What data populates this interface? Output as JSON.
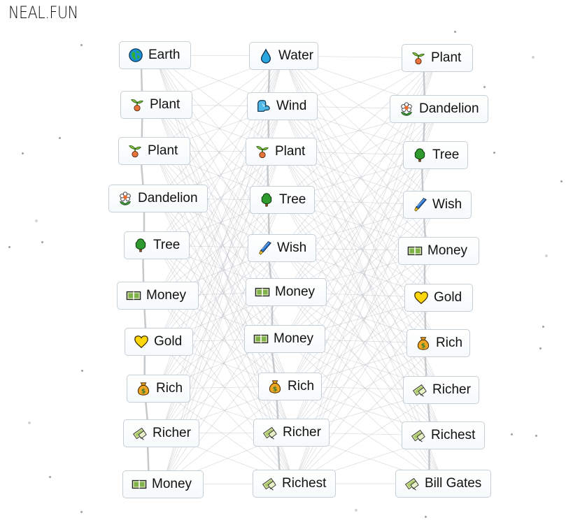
{
  "logo": "NEAL.FUN",
  "columns": [
    {
      "items": [
        {
          "label": "Earth",
          "icon": "earth"
        },
        {
          "label": "Plant",
          "icon": "plant"
        },
        {
          "label": "Plant",
          "icon": "plant"
        },
        {
          "label": "Dandelion",
          "icon": "dandelion"
        },
        {
          "label": "Tree",
          "icon": "tree"
        },
        {
          "label": "Money",
          "icon": "money"
        },
        {
          "label": "Gold",
          "icon": "gold"
        },
        {
          "label": "Rich",
          "icon": "rich"
        },
        {
          "label": "Richer",
          "icon": "richer"
        },
        {
          "label": "Money",
          "icon": "money"
        }
      ]
    },
    {
      "items": [
        {
          "label": "Water",
          "icon": "water"
        },
        {
          "label": "Wind",
          "icon": "wind"
        },
        {
          "label": "Plant",
          "icon": "plant"
        },
        {
          "label": "Tree",
          "icon": "tree"
        },
        {
          "label": "Wish",
          "icon": "wish"
        },
        {
          "label": "Money",
          "icon": "money"
        },
        {
          "label": "Money",
          "icon": "money"
        },
        {
          "label": "Rich",
          "icon": "rich"
        },
        {
          "label": "Richer",
          "icon": "richer"
        },
        {
          "label": "Richest",
          "icon": "richer"
        }
      ]
    },
    {
      "items": [
        {
          "label": "Plant",
          "icon": "plant"
        },
        {
          "label": "Dandelion",
          "icon": "dandelion"
        },
        {
          "label": "Tree",
          "icon": "tree"
        },
        {
          "label": "Wish",
          "icon": "wish"
        },
        {
          "label": "Money",
          "icon": "money"
        },
        {
          "label": "Gold",
          "icon": "gold"
        },
        {
          "label": "Rich",
          "icon": "rich"
        },
        {
          "label": "Richer",
          "icon": "richer"
        },
        {
          "label": "Richest",
          "icon": "richer"
        },
        {
          "label": "Bill Gates",
          "icon": "richer"
        }
      ]
    }
  ]
}
